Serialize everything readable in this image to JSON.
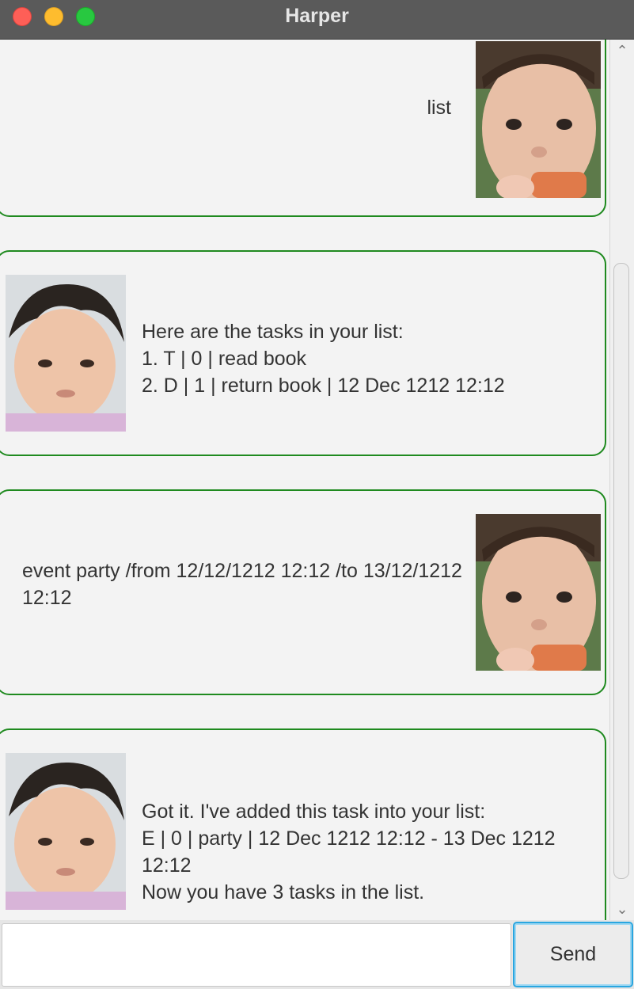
{
  "window": {
    "title": "Harper"
  },
  "messages": [
    {
      "sender": "user",
      "text": "list"
    },
    {
      "sender": "bot",
      "text": "Here are the tasks in your list:\n1. T | 0 | read book\n2. D | 1 | return book | 12 Dec 1212 12:12"
    },
    {
      "sender": "user",
      "text": "event party /from 12/12/1212 12:12 /to 13/12/1212\n12:12"
    },
    {
      "sender": "bot",
      "text": "Got it. I've added this task into your list:\nE | 0 | party | 12 Dec 1212 12:12 - 13 Dec 1212 12:12\nNow you have 3 tasks in the list."
    }
  ],
  "input": {
    "value": "",
    "placeholder": ""
  },
  "send_button": {
    "label": "Send"
  },
  "colors": {
    "bubble_border": "#1f8a1f",
    "send_focus": "#2aa6e0",
    "titlebar": "#5a5a5a"
  }
}
